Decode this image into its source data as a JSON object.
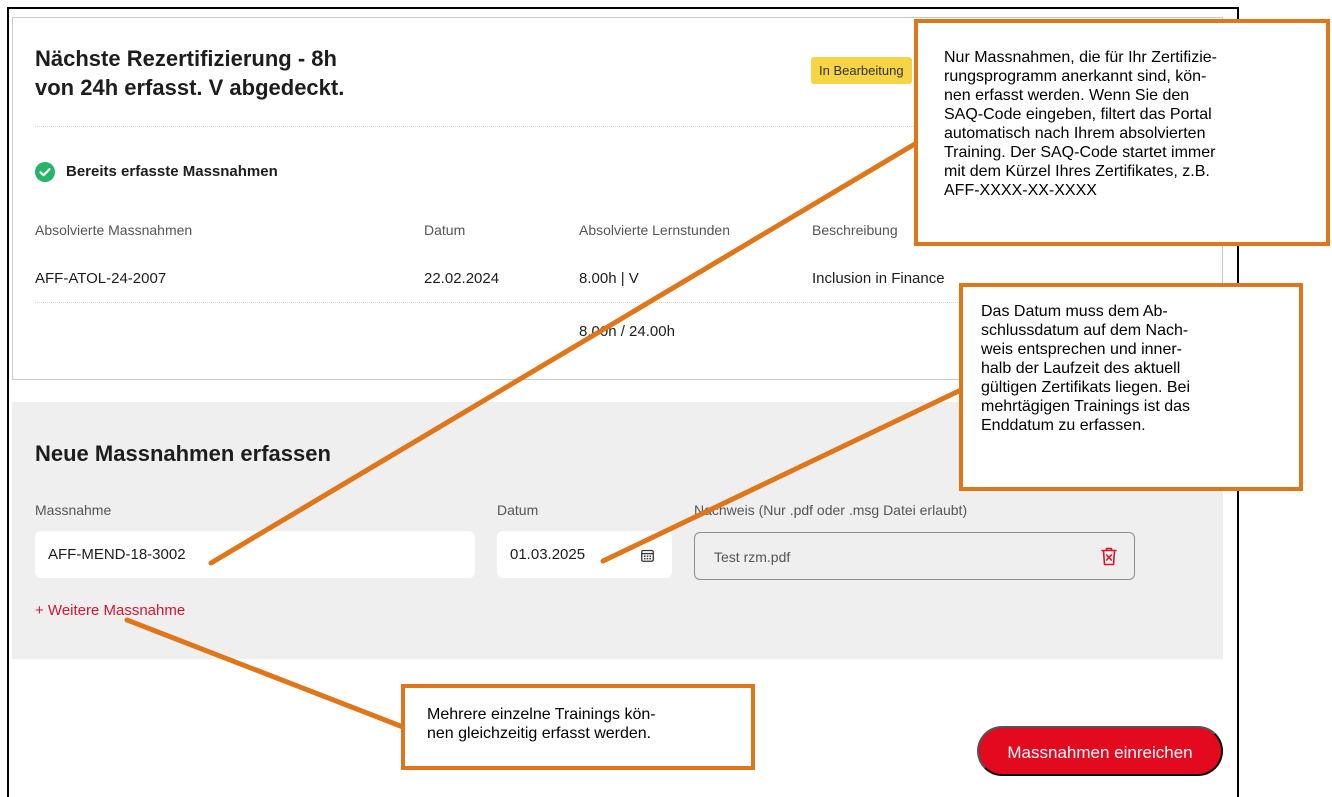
{
  "header": {
    "title_line1": "Nächste Rezertifizierung - 8h",
    "title_line2": "von 24h erfasst. V abgedeckt.",
    "status_badge": "In Bearbeitung"
  },
  "completed": {
    "section_title": "Bereits erfasste Massnahmen",
    "columns": [
      "Absolvierte Massnahmen",
      "Datum",
      "Absolvierte Lernstunden",
      "Beschreibung"
    ],
    "rows": [
      {
        "measure": "AFF-ATOL-24-2007",
        "date": "22.02.2024",
        "hours": "8.00h | V",
        "description": "Inclusion in Finance"
      }
    ],
    "total": "8.00h / 24.00h"
  },
  "new_entry": {
    "section_title": "Neue Massnahmen erfassen",
    "measure_label": "Massnahme",
    "measure_value": "AFF-MEND-18-3002",
    "date_label": "Datum",
    "date_value": "01.03.2025",
    "proof_label": "Nachweis (Nur .pdf oder .msg Datei erlaubt)",
    "proof_file": "Test rzm.pdf",
    "add_more": "+ Weitere Massnahme"
  },
  "submit_label": "Massnahmen einreichen",
  "callouts": {
    "saq_code": "Nur Massnahmen, die für Ihr Zertifizie-\nrungsprogramm anerkannt sind, kön-\nnen erfasst werden. Wenn Sie den\nSAQ-Code eingeben, filtert das Portal\nautomatisch nach Ihrem absolvierten\nTraining. Der SAQ-Code startet immer\nmit dem Kürzel Ihres Zertifikates, z.B.\nAFF-XXXX-XX-XXXX",
    "date": "Das Datum muss dem Ab-\nschlussdatum auf dem Nach-\nweis entsprechen und inner-\nhalb der Laufzeit des aktuell\ngültigen Zertifikats liegen. Bei\nmehrtägigen Trainings ist das\nEnddatum zu erfassen.",
    "multiple": "Mehrere einzelne Trainings kön-\nnen gleichzeitig erfasst werden."
  },
  "colors": {
    "accent_red": "#e3091f",
    "link_red": "#d8152f",
    "badge_yellow": "#f7d443",
    "callout_orange": "#e0761a",
    "check_green": "#27b36a"
  }
}
